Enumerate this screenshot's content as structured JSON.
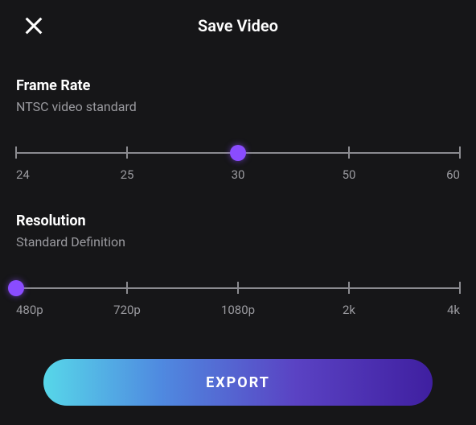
{
  "header": {
    "title": "Save Video"
  },
  "frameRate": {
    "title": "Frame Rate",
    "subtitle": "NTSC video standard",
    "stops": [
      "24",
      "25",
      "30",
      "50",
      "60"
    ],
    "selectedIndex": 2
  },
  "resolution": {
    "title": "Resolution",
    "subtitle": "Standard Definition",
    "stops": [
      "480p",
      "720p",
      "1080p",
      "2k",
      "4k"
    ],
    "selectedIndex": 0
  },
  "export": {
    "label": "EXPORT"
  }
}
